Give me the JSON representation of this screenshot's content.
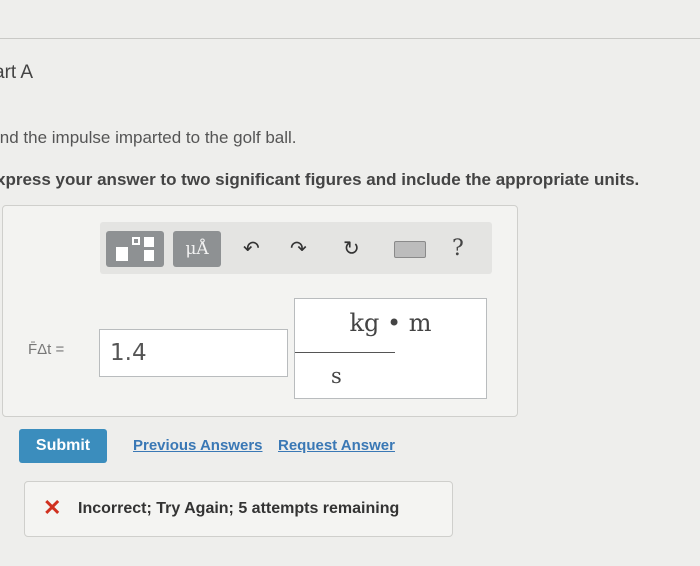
{
  "part": {
    "title": "art A"
  },
  "question": {
    "text": "ind the impulse imparted to the golf ball."
  },
  "instruction": {
    "text": "xpress your answer to two significant figures and include the appropriate units."
  },
  "toolbar": {
    "mu_label": "μÅ",
    "help_label": "?",
    "icons": [
      "templates-icon",
      "units-icon",
      "undo-icon",
      "redo-icon",
      "reset-icon",
      "keyboard-icon",
      "help-icon"
    ]
  },
  "answer": {
    "label": "F̄Δt =",
    "value": "1.4",
    "units_numerator": "kg • m",
    "units_denominator": "s"
  },
  "actions": {
    "submit_label": "Submit",
    "previous_answers_label": "Previous Answers",
    "request_answer_label": "Request Answer"
  },
  "feedback": {
    "text": "Incorrect; Try Again; 5 attempts remaining",
    "status_color": "#d0301f"
  },
  "colors": {
    "submit_bg": "#3b8dbd",
    "link": "#3a78b5",
    "toolbar_button": "#8e9193"
  }
}
